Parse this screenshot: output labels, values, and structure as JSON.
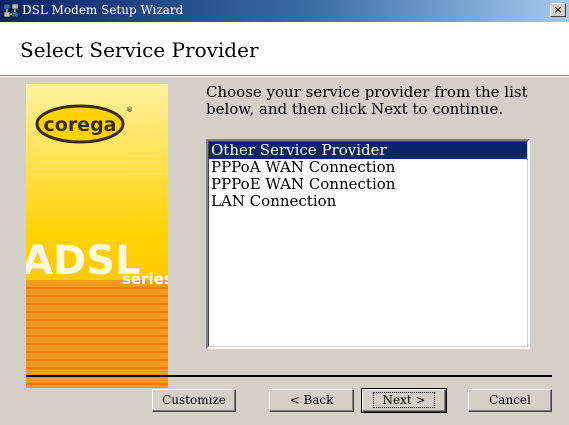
{
  "window": {
    "title": "DSL Modem Setup Wizard",
    "close_label": "×"
  },
  "header": {
    "title": "Select Service Provider"
  },
  "banner": {
    "brand": "corega",
    "registered": "®",
    "product": "ADSL",
    "series": "series",
    "colors": {
      "yellow": "#ffd200",
      "orange": "#f39a1c",
      "deep_orange": "#f07a12"
    }
  },
  "main": {
    "instructions_line1": "Choose your service provider from the list",
    "instructions_line2": "below, and then click Next to continue.",
    "providers": [
      "Other Service Provider",
      "PPPoA WAN Connection",
      "PPPoE WAN Connection",
      "LAN Connection"
    ],
    "selected_index": 0
  },
  "buttons": {
    "customize": "Customize",
    "back": "< Back",
    "next": "Next >",
    "cancel": "Cancel"
  }
}
